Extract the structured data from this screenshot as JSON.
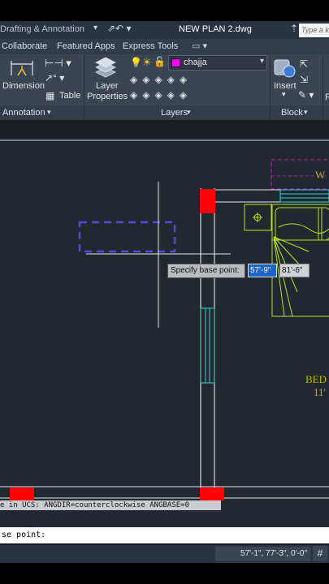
{
  "title_bar": {
    "workspace": "Drafting & Annotation",
    "document_title": "NEW PLAN 2.dwg",
    "search_placeholder": "Type a k"
  },
  "ribbon_tabs": [
    "Collaborate",
    "Featured Apps",
    "Express Tools"
  ],
  "ribbon": {
    "dimension_label": "Dimension",
    "table_label": "Table",
    "layer_properties_label_1": "Layer",
    "layer_properties_label_2": "Properties",
    "insert_label": "Insert",
    "current_layer": "chajja",
    "current_layer_color": "#ff00ff",
    "panels": {
      "annotation": "Annotation",
      "layers": "Layers",
      "block": "Block"
    }
  },
  "drawing": {
    "text_w": "W",
    "text_bed": "BED",
    "text_dim": "11'"
  },
  "dynamic_input": {
    "prompt": "Specify base point:",
    "x_value": "57'-9\"",
    "y_value": "81'-6\""
  },
  "command_history": "e in UCS:  ANGDIR=counterclockwise  ANGBASE=0",
  "command_line": "se point:",
  "status_bar": {
    "coordinates": "57'-1\", 77'-3\", 0'-0\""
  },
  "colors": {
    "canvas_bg": "#212830",
    "wall_red": "#ff0000",
    "furniture_green": "#b5e41c",
    "window_cyan": "#2ed3d3",
    "selection_blue": "#5a46d8",
    "label_magenta": "#c020c0",
    "text_yellow": "#c8b400"
  }
}
